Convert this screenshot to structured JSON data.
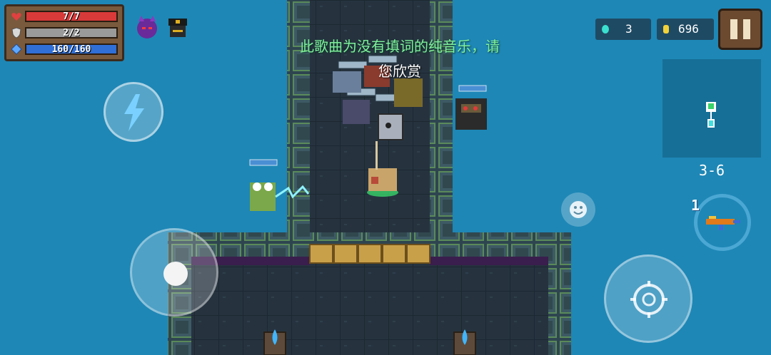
{
  "hud": {
    "health": "7/7",
    "armor": "2/2",
    "energy": "160/160",
    "gems": "3",
    "coins": "696",
    "level": "3-6",
    "weapon_ammo": "1"
  },
  "lyrics": {
    "line1": "此歌曲为没有填词的纯音乐，请",
    "line2": "您欣赏"
  },
  "colors": {
    "health_bar": "#d83a3a",
    "armor_bar": "#9a9a9a",
    "energy_bar": "#2f6fd6",
    "lyric_green": "#7ff09b",
    "water": "#1e87b6",
    "floor": "#243240",
    "wall": "#3d5560",
    "crate": "#c9a04a"
  },
  "icons": {
    "health": "heart-icon",
    "armor": "shield-icon",
    "energy": "diamond-icon",
    "buff1": "demon-horns-buff-icon",
    "buff2": "officer-hat-buff-icon",
    "skill": "lightning-icon",
    "emote": "smiley-icon",
    "pause": "pause-icon",
    "gem": "gem-icon",
    "coin": "coin-icon",
    "fire": "crosshair-icon",
    "weapon": "rifle-icon"
  }
}
